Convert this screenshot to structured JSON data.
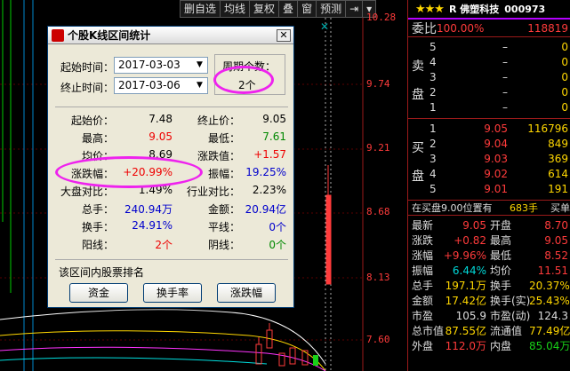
{
  "toolbar": [
    "删自选",
    "均线",
    "复权",
    "叠",
    "窗",
    "预测"
  ],
  "y_axis": [
    "10.28",
    "9.74",
    "9.21",
    "8.68",
    "8.13",
    "7.60"
  ],
  "stock": {
    "stars": "★★★",
    "name": "R 佛塑科技",
    "code": "000973"
  },
  "weibi": {
    "label": "委比",
    "value": "100.00%",
    "vol": "118819"
  },
  "sell": [
    {
      "n": "5",
      "p": "–",
      "v": "0"
    },
    {
      "n": "4",
      "p": "–",
      "v": "0"
    },
    {
      "n": "3",
      "p": "–",
      "v": "0"
    },
    {
      "n": "2",
      "p": "–",
      "v": "0"
    },
    {
      "n": "1",
      "p": "–",
      "v": "0"
    }
  ],
  "sell_label": [
    "卖",
    "盘"
  ],
  "buy": [
    {
      "n": "1",
      "p": "9.05",
      "v": "116796"
    },
    {
      "n": "2",
      "p": "9.04",
      "v": "849"
    },
    {
      "n": "3",
      "p": "9.03",
      "v": "369"
    },
    {
      "n": "4",
      "p": "9.02",
      "v": "614"
    },
    {
      "n": "5",
      "p": "9.01",
      "v": "191"
    }
  ],
  "buy_label": [
    "买",
    "盘"
  ],
  "buy_status": {
    "text": "在买盘9.00位置有",
    "vol": "683手",
    "label": "买单"
  },
  "quotes": [
    {
      "k1": "最新",
      "v1": "9.05",
      "k2": "开盘",
      "v2": "8.70"
    },
    {
      "k1": "涨跌",
      "v1": "+0.82",
      "k2": "最高",
      "v2": "9.05"
    },
    {
      "k1": "涨幅",
      "v1": "+9.96%",
      "k2": "最低",
      "v2": "8.52"
    },
    {
      "k1": "振幅",
      "v1": "6.44%",
      "k2": "均价",
      "v2": "11.51"
    },
    {
      "k1": "总手",
      "v1": "197.1万",
      "k2": "换手",
      "v2": "20.37%"
    },
    {
      "k1": "金额",
      "v1": "17.42亿",
      "k2": "换手(实)",
      "v2": "25.43%"
    },
    {
      "k1": "市盈",
      "v1": "105.9",
      "k2": "市盈(动)",
      "v2": "124.3"
    },
    {
      "k1": "总市值",
      "v1": "87.55亿",
      "k2": "流通值",
      "v2": "77.49亿"
    },
    {
      "k1": "外盘",
      "v1": "112.0万",
      "k2": "内盘",
      "v2": "85.04万"
    }
  ],
  "dialog": {
    "title": "个股K线区间统计",
    "start_label": "起始时间：",
    "start_value": "2017-03-03",
    "end_label": "终止时间：",
    "end_value": "2017-03-06",
    "period_label": "周期个数：",
    "period_value": "2个",
    "stats": [
      {
        "k1": "起始价：",
        "v1": "7.48",
        "k2": "终止价：",
        "v2": "9.05"
      },
      {
        "k1": "最高：",
        "v1": "9.05",
        "k2": "最低：",
        "v2": "7.61"
      },
      {
        "k1": "均价：",
        "v1": "8.69",
        "k2": "涨跌值：",
        "v2": "+1.57"
      },
      {
        "k1": "涨跌幅：",
        "v1": "+20.99%",
        "k2": "振幅：",
        "v2": "19.25%"
      },
      {
        "k1": "大盘对比：",
        "v1": "1.49%",
        "k2": "行业对比：",
        "v2": "2.23%"
      },
      {
        "k1": "总手：",
        "v1": "240.94万",
        "k2": "金额：",
        "v2": "20.94亿"
      },
      {
        "k1": "换手：",
        "v1": "24.91%",
        "k2": "平线：",
        "v2": "0个"
      },
      {
        "k1": "阳线：",
        "v1": "2个",
        "k2": "阴线：",
        "v2": "0个"
      }
    ],
    "rank_label": "该区间内股票排名",
    "buttons": [
      "资金",
      "换手率",
      "涨跌幅"
    ]
  },
  "colors": {
    "up": "#ff3b3b",
    "down": "#18d018",
    "highlight": "#ee22ee",
    "accent": "#ffd700"
  }
}
